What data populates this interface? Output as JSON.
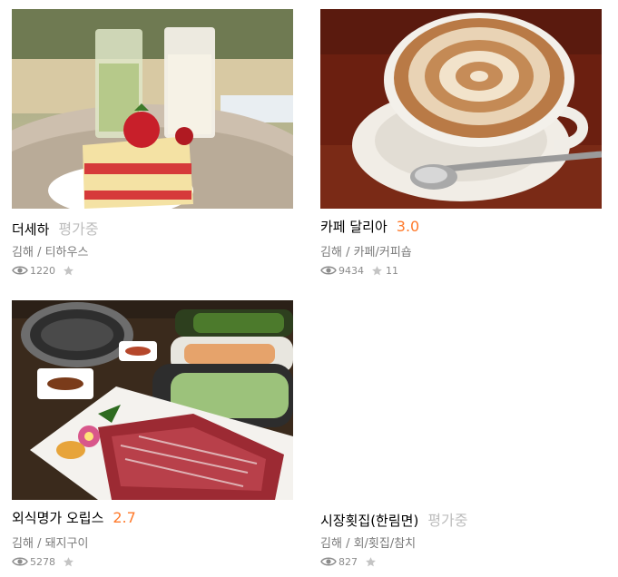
{
  "restaurants": [
    {
      "name": "더세하",
      "rating": "평가중",
      "rating_state": "pending",
      "region": "김해",
      "category": "티하우스",
      "views": "1220",
      "reviews": "",
      "image_icon": "cake-drinks-photo"
    },
    {
      "name": "카페 달리아",
      "rating": "3.0",
      "rating_state": "scored",
      "region": "김해",
      "category": "카페/커피숍",
      "views": "9434",
      "reviews": "11",
      "image_icon": "latte-art-photo"
    },
    {
      "name": "외식명가 오립스",
      "rating": "2.7",
      "rating_state": "scored",
      "region": "김해",
      "category": "돼지구이",
      "views": "5278",
      "reviews": "",
      "image_icon": "grill-meat-photo"
    },
    {
      "name": "시장횟집(한림면)",
      "rating": "평가중",
      "rating_state": "pending",
      "region": "김해",
      "category": "회/횟집/참치",
      "views": "827",
      "reviews": "",
      "image_icon": ""
    }
  ],
  "separator": "/",
  "colors": {
    "rating_scored": "#ff792a",
    "rating_pending": "#bdbdbd",
    "meta_text": "#7a7a7a"
  }
}
